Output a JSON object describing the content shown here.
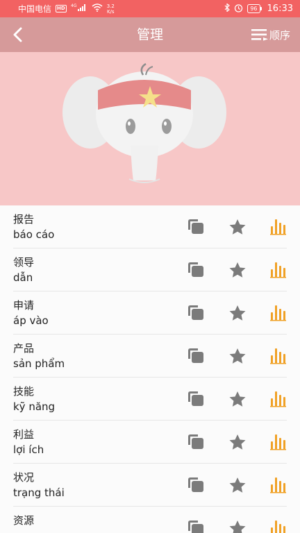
{
  "status_bar": {
    "carrier": "中国电信",
    "hd": "HD",
    "network": "4G",
    "speed_value": "3.2",
    "speed_unit": "K/s",
    "battery": "96",
    "time": "16:33"
  },
  "header": {
    "title": "管理",
    "order_label": "顺序",
    "back_icon": "chevron-left-icon",
    "order_icon": "sort-list-icon"
  },
  "colors": {
    "status_bar": "#f26262",
    "app_bar": "#d69a9a",
    "hero": "#f7c7c7",
    "icon_gray": "#7b7b7b",
    "level_orange": "#f0a126"
  },
  "words": [
    {
      "zh": "报告",
      "vi": "báo cáo"
    },
    {
      "zh": "领导",
      "vi": "dẫn"
    },
    {
      "zh": "申请",
      "vi": "áp vào"
    },
    {
      "zh": "产品",
      "vi": "sản phẩm"
    },
    {
      "zh": "技能",
      "vi": "kỹ năng"
    },
    {
      "zh": "利益",
      "vi": "lợi ích"
    },
    {
      "zh": "状况",
      "vi": "trạng thái"
    },
    {
      "zh": "资源",
      "vi": ""
    }
  ],
  "row_icons": {
    "copy": "copy-icon",
    "star": "star-icon",
    "level": "level-bars-icon"
  }
}
